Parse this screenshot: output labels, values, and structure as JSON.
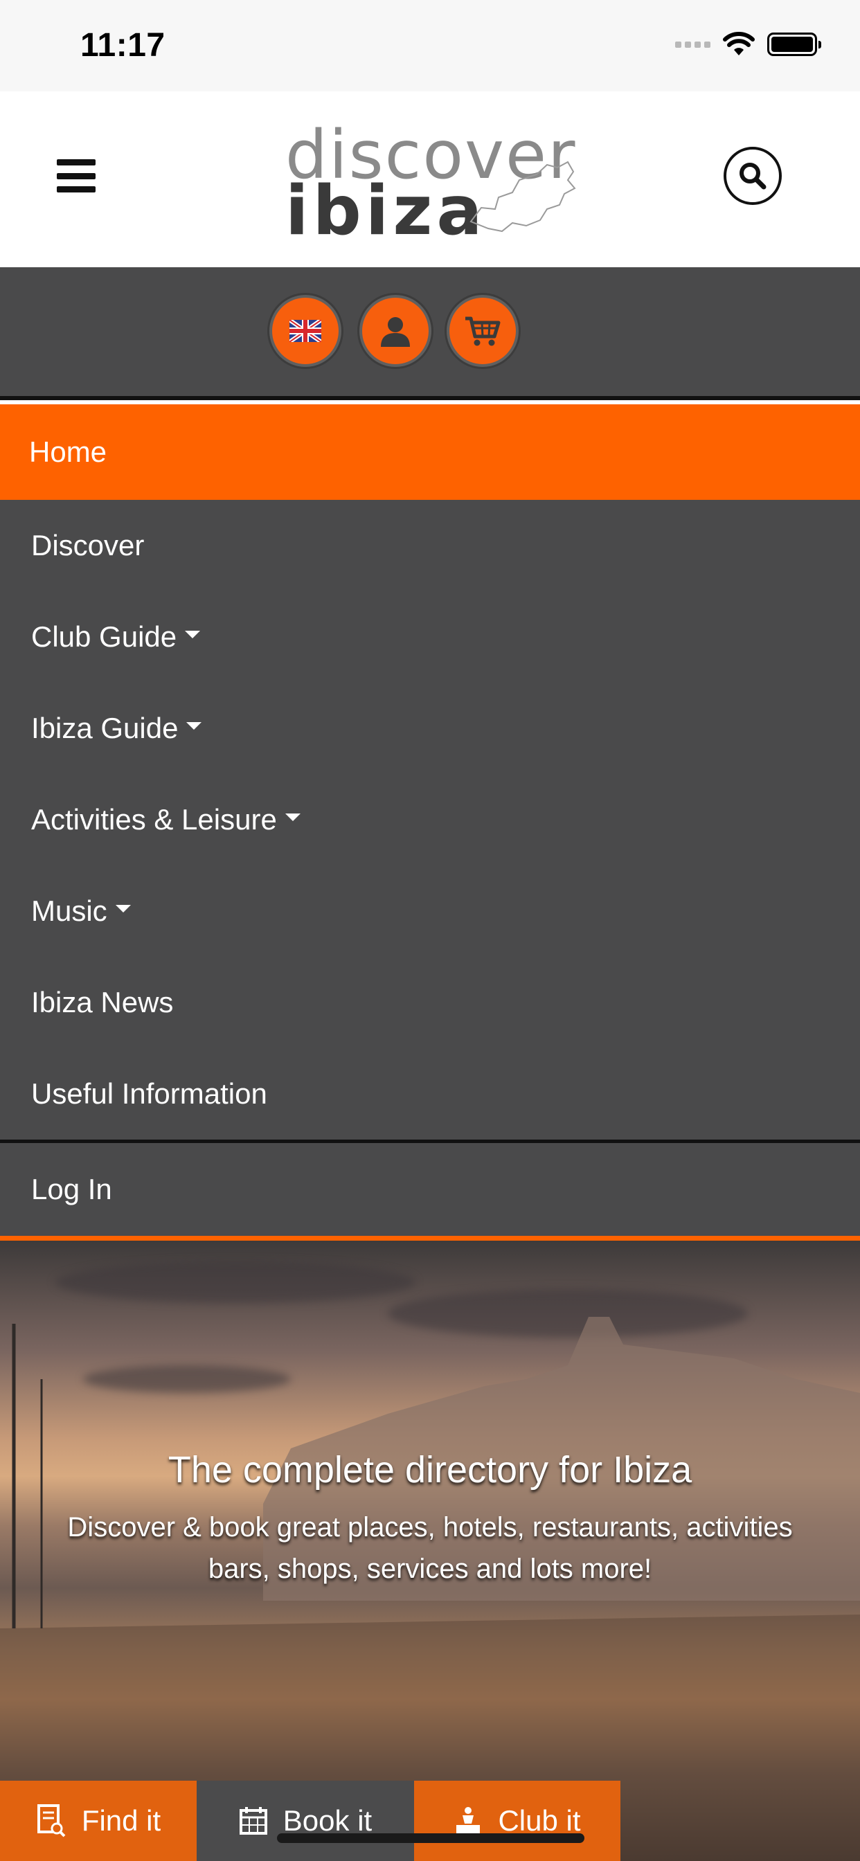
{
  "status_bar": {
    "time": "11:17"
  },
  "header": {
    "logo_line1": "discover",
    "logo_line2": "ibiza"
  },
  "toolbar": {
    "buttons": [
      "language-uk-flag",
      "account",
      "cart"
    ]
  },
  "menu": {
    "items": [
      {
        "label": "Home",
        "active": true,
        "dropdown": false
      },
      {
        "label": "Discover",
        "active": false,
        "dropdown": false
      },
      {
        "label": "Club Guide",
        "active": false,
        "dropdown": true
      },
      {
        "label": "Ibiza Guide",
        "active": false,
        "dropdown": true
      },
      {
        "label": "Activities & Leisure",
        "active": false,
        "dropdown": true
      },
      {
        "label": "Music",
        "active": false,
        "dropdown": true
      },
      {
        "label": "Ibiza News",
        "active": false,
        "dropdown": false
      },
      {
        "label": "Useful Information",
        "active": false,
        "dropdown": false
      }
    ],
    "login": "Log In"
  },
  "hero": {
    "title": "The complete directory for Ibiza",
    "subtitle_line1": "Discover & book great places, hotels, restaurants, activities",
    "subtitle_line2": "bars, shops, services and lots more!"
  },
  "bottom_bar": {
    "find": "Find it",
    "book": "Book it",
    "club": "Club it"
  },
  "colors": {
    "accent": "#fe6200",
    "menu_bg": "#4a4a4b",
    "tab_orange": "#e1620f"
  }
}
